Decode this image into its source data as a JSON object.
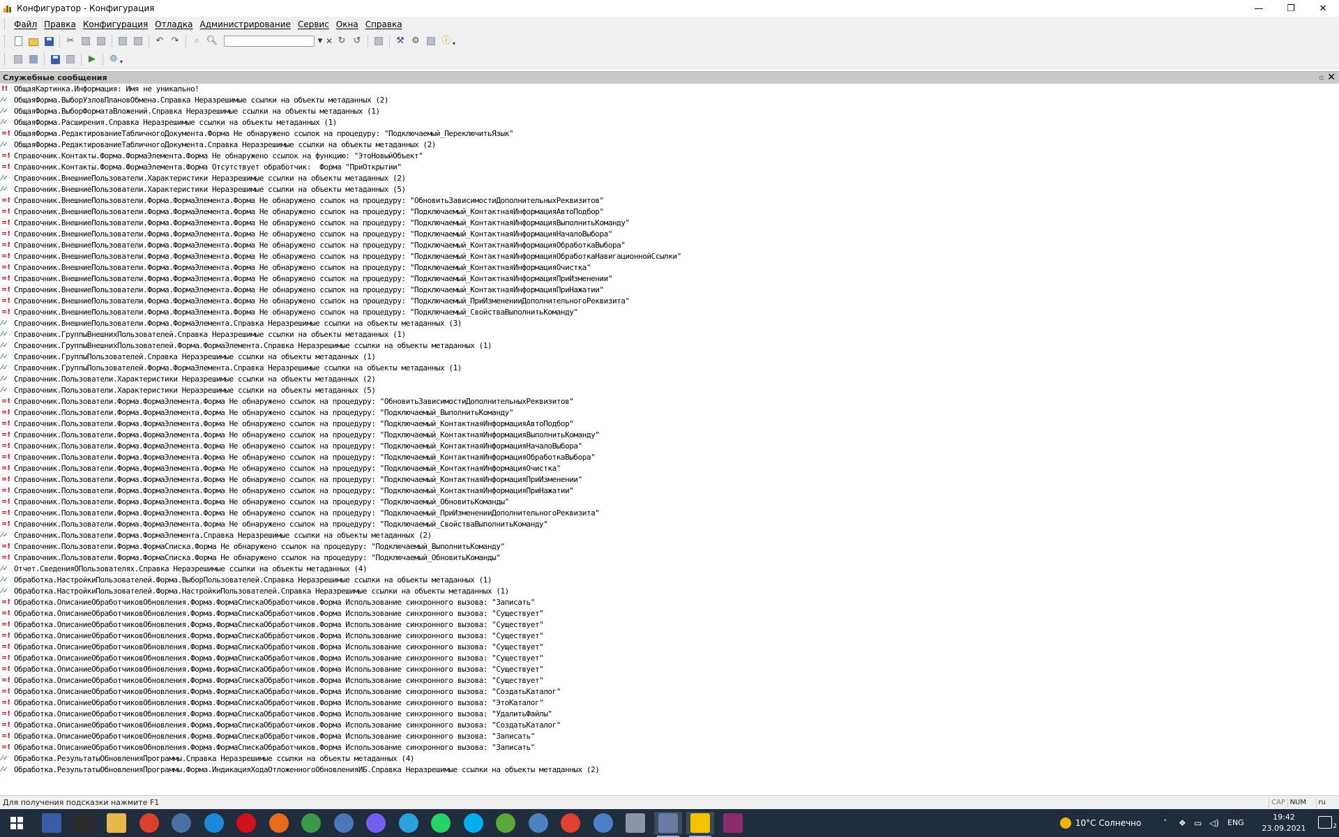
{
  "window": {
    "title": "Конфигуратор - Конфигурация",
    "controls": [
      "—",
      "❐",
      "✕"
    ]
  },
  "menu": [
    "Файл",
    "Правка",
    "Конфигурация",
    "Отладка",
    "Администрирование",
    "Сервис",
    "Окна",
    "Справка"
  ],
  "panel": {
    "title": "Служебные сообщения",
    "pin": "▫",
    "close": "✕"
  },
  "messages": [
    {
      "type": "error",
      "text": "ОбщаяКартинка.Информация: Имя не уникально!"
    },
    {
      "type": "link",
      "text": "ОбщаяФорма.ВыборУзловПлановОбмена.Справка Неразрешимые ссылки на объекты метаданных (2)"
    },
    {
      "type": "link",
      "text": "ОбщаяФорма.ВыборФорматаВложений.Справка Неразрешимые ссылки на объекты метаданных (1)"
    },
    {
      "type": "link",
      "text": "ОбщаяФорма.Расширения.Справка Неразрешимые ссылки на объекты метаданных (1)"
    },
    {
      "type": "warn",
      "text": "ОбщаяФорма.РедактированиеТабличногоДокумента.Форма Не обнаружено ссылок на процедуру: \"Подключаемый_ПереключитьЯзык\""
    },
    {
      "type": "link",
      "text": "ОбщаяФорма.РедактированиеТабличногоДокумента.Справка Неразрешимые ссылки на объекты метаданных (2)"
    },
    {
      "type": "warn",
      "text": "Справочник.Контакты.Форма.ФормаЭлемента.Форма Не обнаружено ссылок на функцию: \"ЭтоНовыйОбъект\""
    },
    {
      "type": "warn",
      "text": "Справочник.Контакты.Форма.ФормаЭлемента.Форма Отсутствует обработчик:  Форма \"ПриОткрытии\""
    },
    {
      "type": "link",
      "text": "Справочник.ВнешниеПользователи.Характеристики Неразрешимые ссылки на объекты метаданных (2)"
    },
    {
      "type": "link",
      "text": "Справочник.ВнешниеПользователи.Характеристики Неразрешимые ссылки на объекты метаданных (5)"
    },
    {
      "type": "warn",
      "text": "Справочник.ВнешниеПользователи.Форма.ФормаЭлемента.Форма Не обнаружено ссылок на процедуру: \"ОбновитьЗависимостиДополнительныхРеквизитов\""
    },
    {
      "type": "warn",
      "text": "Справочник.ВнешниеПользователи.Форма.ФормаЭлемента.Форма Не обнаружено ссылок на процедуру: \"Подключаемый_КонтактнаяИнформацияАвтоПодбор\""
    },
    {
      "type": "warn",
      "text": "Справочник.ВнешниеПользователи.Форма.ФормаЭлемента.Форма Не обнаружено ссылок на процедуру: \"Подключаемый_КонтактнаяИнформацияВыполнитьКоманду\""
    },
    {
      "type": "warn",
      "text": "Справочник.ВнешниеПользователи.Форма.ФормаЭлемента.Форма Не обнаружено ссылок на процедуру: \"Подключаемый_КонтактнаяИнформацияНачалоВыбора\""
    },
    {
      "type": "warn",
      "text": "Справочник.ВнешниеПользователи.Форма.ФормаЭлемента.Форма Не обнаружено ссылок на процедуру: \"Подключаемый_КонтактнаяИнформацияОбработкаВыбора\""
    },
    {
      "type": "warn",
      "text": "Справочник.ВнешниеПользователи.Форма.ФормаЭлемента.Форма Не обнаружено ссылок на процедуру: \"Подключаемый_КонтактнаяИнформацияОбработкаНавигационнойСсылки\""
    },
    {
      "type": "warn",
      "text": "Справочник.ВнешниеПользователи.Форма.ФормаЭлемента.Форма Не обнаружено ссылок на процедуру: \"Подключаемый_КонтактнаяИнформацияОчистка\""
    },
    {
      "type": "warn",
      "text": "Справочник.ВнешниеПользователи.Форма.ФормаЭлемента.Форма Не обнаружено ссылок на процедуру: \"Подключаемый_КонтактнаяИнформацияПриИзменении\""
    },
    {
      "type": "warn",
      "text": "Справочник.ВнешниеПользователи.Форма.ФормаЭлемента.Форма Не обнаружено ссылок на процедуру: \"Подключаемый_КонтактнаяИнформацияПриНажатии\""
    },
    {
      "type": "warn",
      "text": "Справочник.ВнешниеПользователи.Форма.ФормаЭлемента.Форма Не обнаружено ссылок на процедуру: \"Подключаемый_ПриИзмененииДополнительногоРеквизита\""
    },
    {
      "type": "warn",
      "text": "Справочник.ВнешниеПользователи.Форма.ФормаЭлемента.Форма Не обнаружено ссылок на процедуру: \"Подключаемый_СвойстваВыполнитьКоманду\""
    },
    {
      "type": "link",
      "text": "Справочник.ВнешниеПользователи.Форма.ФормаЭлемента.Справка Неразрешимые ссылки на объекты метаданных (3)"
    },
    {
      "type": "link",
      "text": "Справочник.ГруппыВнешнихПользователей.Справка Неразрешимые ссылки на объекты метаданных (1)"
    },
    {
      "type": "link",
      "text": "Справочник.ГруппыВнешнихПользователей.Форма.ФормаЭлемента.Справка Неразрешимые ссылки на объекты метаданных (1)"
    },
    {
      "type": "link",
      "text": "Справочник.ГруппыПользователей.Справка Неразрешимые ссылки на объекты метаданных (1)"
    },
    {
      "type": "link",
      "text": "Справочник.ГруппыПользователей.Форма.ФормаЭлемента.Справка Неразрешимые ссылки на объекты метаданных (1)"
    },
    {
      "type": "link",
      "text": "Справочник.Пользователи.Характеристики Неразрешимые ссылки на объекты метаданных (2)"
    },
    {
      "type": "link",
      "text": "Справочник.Пользователи.Характеристики Неразрешимые ссылки на объекты метаданных (5)"
    },
    {
      "type": "warn",
      "text": "Справочник.Пользователи.Форма.ФормаЭлемента.Форма Не обнаружено ссылок на процедуру: \"ОбновитьЗависимостиДополнительныхРеквизитов\""
    },
    {
      "type": "warn",
      "text": "Справочник.Пользователи.Форма.ФормаЭлемента.Форма Не обнаружено ссылок на процедуру: \"Подключаемый_ВыполнитьКоманду\""
    },
    {
      "type": "warn",
      "text": "Справочник.Пользователи.Форма.ФормаЭлемента.Форма Не обнаружено ссылок на процедуру: \"Подключаемый_КонтактнаяИнформацияАвтоПодбор\""
    },
    {
      "type": "warn",
      "text": "Справочник.Пользователи.Форма.ФормаЭлемента.Форма Не обнаружено ссылок на процедуру: \"Подключаемый_КонтактнаяИнформацияВыполнитьКоманду\""
    },
    {
      "type": "warn",
      "text": "Справочник.Пользователи.Форма.ФормаЭлемента.Форма Не обнаружено ссылок на процедуру: \"Подключаемый_КонтактнаяИнформацияНачалоВыбора\""
    },
    {
      "type": "warn",
      "text": "Справочник.Пользователи.Форма.ФормаЭлемента.Форма Не обнаружено ссылок на процедуру: \"Подключаемый_КонтактнаяИнформацияОбработкаВыбора\""
    },
    {
      "type": "warn",
      "text": "Справочник.Пользователи.Форма.ФормаЭлемента.Форма Не обнаружено ссылок на процедуру: \"Подключаемый_КонтактнаяИнформацияОчистка\""
    },
    {
      "type": "warn",
      "text": "Справочник.Пользователи.Форма.ФормаЭлемента.Форма Не обнаружено ссылок на процедуру: \"Подключаемый_КонтактнаяИнформацияПриИзменении\""
    },
    {
      "type": "warn",
      "text": "Справочник.Пользователи.Форма.ФормаЭлемента.Форма Не обнаружено ссылок на процедуру: \"Подключаемый_КонтактнаяИнформацияПриНажатии\""
    },
    {
      "type": "warn",
      "text": "Справочник.Пользователи.Форма.ФормаЭлемента.Форма Не обнаружено ссылок на процедуру: \"Подключаемый_ОбновитьКоманды\""
    },
    {
      "type": "warn",
      "text": "Справочник.Пользователи.Форма.ФормаЭлемента.Форма Не обнаружено ссылок на процедуру: \"Подключаемый_ПриИзмененииДополнительногоРеквизита\""
    },
    {
      "type": "warn",
      "text": "Справочник.Пользователи.Форма.ФормаЭлемента.Форма Не обнаружено ссылок на процедуру: \"Подключаемый_СвойстваВыполнитьКоманду\""
    },
    {
      "type": "link",
      "text": "Справочник.Пользователи.Форма.ФормаЭлемента.Справка Неразрешимые ссылки на объекты метаданных (2)"
    },
    {
      "type": "warn",
      "text": "Справочник.Пользователи.Форма.ФормаСписка.Форма Не обнаружено ссылок на процедуру: \"Подключаемый_ВыполнитьКоманду\""
    },
    {
      "type": "warn",
      "text": "Справочник.Пользователи.Форма.ФормаСписка.Форма Не обнаружено ссылок на процедуру: \"Подключаемый_ОбновитьКоманды\""
    },
    {
      "type": "link",
      "text": "Отчет.СведенияОПользователях.Справка Неразрешимые ссылки на объекты метаданных (4)"
    },
    {
      "type": "link",
      "text": "Обработка.НастройкиПользователей.Форма.ВыборПользователей.Справка Неразрешимые ссылки на объекты метаданных (1)"
    },
    {
      "type": "link",
      "text": "Обработка.НастройкиПользователей.Форма.НастройкиПользователей.Справка Неразрешимые ссылки на объекты метаданных (1)"
    },
    {
      "type": "warn",
      "text": "Обработка.ОписаниеОбработчиковОбновления.Форма.ФормаСпискаОбработчиков.Форма Использование синхронного вызова: \"Записать\""
    },
    {
      "type": "warn",
      "text": "Обработка.ОписаниеОбработчиковОбновления.Форма.ФормаСпискаОбработчиков.Форма Использование синхронного вызова: \"Существует\""
    },
    {
      "type": "warn",
      "text": "Обработка.ОписаниеОбработчиковОбновления.Форма.ФормаСпискаОбработчиков.Форма Использование синхронного вызова: \"Существует\""
    },
    {
      "type": "warn",
      "text": "Обработка.ОписаниеОбработчиковОбновления.Форма.ФормаСпискаОбработчиков.Форма Использование синхронного вызова: \"Существует\""
    },
    {
      "type": "warn",
      "text": "Обработка.ОписаниеОбработчиковОбновления.Форма.ФормаСпискаОбработчиков.Форма Использование синхронного вызова: \"Существует\""
    },
    {
      "type": "warn",
      "text": "Обработка.ОписаниеОбработчиковОбновления.Форма.ФормаСпискаОбработчиков.Форма Использование синхронного вызова: \"Существует\""
    },
    {
      "type": "warn",
      "text": "Обработка.ОписаниеОбработчиковОбновления.Форма.ФормаСпискаОбработчиков.Форма Использование синхронного вызова: \"Существует\""
    },
    {
      "type": "warn",
      "text": "Обработка.ОписаниеОбработчиковОбновления.Форма.ФормаСпискаОбработчиков.Форма Использование синхронного вызова: \"Существует\""
    },
    {
      "type": "warn",
      "text": "Обработка.ОписаниеОбработчиковОбновления.Форма.ФормаСпискаОбработчиков.Форма Использование синхронного вызова: \"СоздатьКаталог\""
    },
    {
      "type": "warn",
      "text": "Обработка.ОписаниеОбработчиковОбновления.Форма.ФормаСпискаОбработчиков.Форма Использование синхронного вызова: \"ЭтоКаталог\""
    },
    {
      "type": "warn",
      "text": "Обработка.ОписаниеОбработчиковОбновления.Форма.ФормаСпискаОбработчиков.Форма Использование синхронного вызова: \"УдалитьФайлы\""
    },
    {
      "type": "warn",
      "text": "Обработка.ОписаниеОбработчиковОбновления.Форма.ФормаСпискаОбработчиков.Форма Использование синхронного вызова: \"СоздатьКаталог\""
    },
    {
      "type": "warn",
      "text": "Обработка.ОписаниеОбработчиковОбновления.Форма.ФормаСпискаОбработчиков.Форма Использование синхронного вызова: \"Записать\""
    },
    {
      "type": "warn",
      "text": "Обработка.ОписаниеОбработчиковОбновления.Форма.ФормаСпискаОбработчиков.Форма Использование синхронного вызова: \"Записать\""
    },
    {
      "type": "link",
      "text": "Обработка.РезультатыОбновленияПрограммы.Справка Неразрешимые ссылки на объекты метаданных (4)"
    },
    {
      "type": "link",
      "text": "Обработка.РезультатыОбновленияПрограммы.Форма.ИндикацияХодаОтложенногоОбновленияИБ.Справка Неразрешимые ссылки на объекты метаданных (2)"
    }
  ],
  "icon_glyphs": {
    "error": "!!",
    "warn": "=!",
    "link": "⁄✓"
  },
  "statusbar": {
    "hint": "Для получения подсказки нажмите F1",
    "cap": "CAP",
    "num": "NUM",
    "lang": "ru"
  },
  "taskbar": {
    "apps": [
      {
        "name": "save-app",
        "color": "#3a5da8"
      },
      {
        "name": "terminal-app",
        "color": "#2b2b2b"
      },
      {
        "name": "explorer-app",
        "color": "#e8b84a"
      },
      {
        "name": "anydesk-app",
        "color": "#d9412b"
      },
      {
        "name": "remote-desktop-app",
        "color": "#4a6fa5"
      },
      {
        "name": "edge-app",
        "color": "#1b8ad8"
      },
      {
        "name": "opera-app",
        "color": "#d0101a"
      },
      {
        "name": "firefox-app",
        "color": "#e76a1d"
      },
      {
        "name": "chrome-app",
        "color": "#3a9a48"
      },
      {
        "name": "mail-app",
        "color": "#4b76b8"
      },
      {
        "name": "viber-app",
        "color": "#7360f2"
      },
      {
        "name": "telegram-app",
        "color": "#2aa3dc"
      },
      {
        "name": "whatsapp-app",
        "color": "#25d366"
      },
      {
        "name": "skype-app",
        "color": "#00aff0"
      },
      {
        "name": "sync-app",
        "color": "#5aa83a"
      },
      {
        "name": "qbittorrent-app",
        "color": "#4a82c4"
      },
      {
        "name": "anydesk2-app",
        "color": "#e0402e"
      },
      {
        "name": "phone-app",
        "color": "#4a80c8"
      },
      {
        "name": "settings-app",
        "color": "#8a96a6"
      },
      {
        "name": "configurator-app",
        "color": "#6a7aa0"
      },
      {
        "name": "1c-app",
        "color": "#f5c400"
      },
      {
        "name": "pdf-app",
        "color": "#8b2d6a"
      }
    ],
    "weather": "10°C  Солнечно",
    "lang": "ENG",
    "time": "19:42",
    "date": "23.09.2021",
    "notifications": "2"
  }
}
